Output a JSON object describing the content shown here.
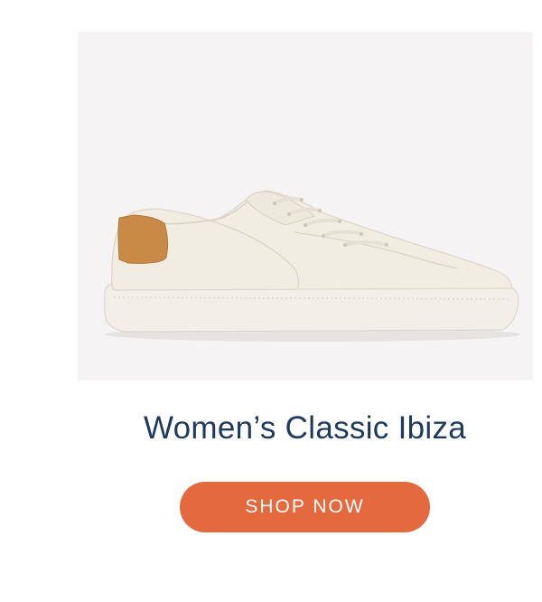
{
  "product": {
    "image": {
      "subject": "sneaker-icon",
      "background_color": "#f5f3f4",
      "shoe_color": "#f1ede3",
      "heel_tab_color": "#c98a47"
    },
    "title": "Women’s Classic Ibiza",
    "title_color": "#1e3a5c"
  },
  "cta": {
    "label": "SHOP NOW",
    "color": "#e4693e"
  }
}
